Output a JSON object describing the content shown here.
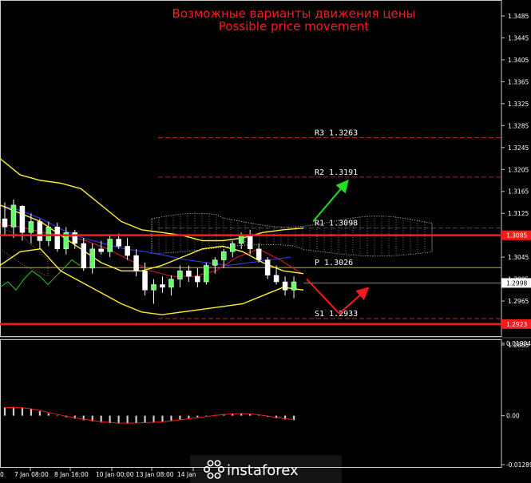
{
  "header": {
    "title_ru": "Возможные варианты движения цены",
    "title_en": "Possible price movement"
  },
  "chart_data": {
    "type": "candlestick",
    "ylim": [
      1.2885,
      1.3485
    ],
    "price_ticks": [
      "1.3485",
      "1.3445",
      "1.3405",
      "1.3365",
      "1.3325",
      "1.3285",
      "1.3245",
      "1.3205",
      "1.3165",
      "1.3125",
      "1.3085",
      "1.3045",
      "1.3005",
      "1.2965",
      "1.2925",
      "1.2885"
    ],
    "x_ticks": [
      "7 Jan 08:00",
      "8 Jan 16:00",
      "10 Jan 00:00",
      "13 Jan 08:00",
      "14 Jan"
    ],
    "x_tick_first": "0",
    "levels": [
      {
        "label": "R3",
        "value": "1.3263"
      },
      {
        "label": "R2",
        "value": "1.3191"
      },
      {
        "label": "R1",
        "value": "1.3098"
      },
      {
        "label": "P",
        "value": "1.3026"
      },
      {
        "label": "S1",
        "value": "1.2933"
      }
    ],
    "support_line": "1.3085",
    "resistance_line": "1.2923",
    "current_price": "1.2998",
    "candles": [
      [
        1.3115,
        1.3145,
        1.3085,
        1.31
      ],
      [
        1.31,
        1.315,
        1.308,
        1.314
      ],
      [
        1.3138,
        1.314,
        1.3075,
        1.309
      ],
      [
        1.309,
        1.3125,
        1.307,
        1.311
      ],
      [
        1.311,
        1.3115,
        1.306,
        1.3075
      ],
      [
        1.3075,
        1.311,
        1.3065,
        1.31
      ],
      [
        1.31,
        1.3108,
        1.3055,
        1.306
      ],
      [
        1.306,
        1.31,
        1.305,
        1.309
      ],
      [
        1.309,
        1.3095,
        1.306,
        1.307
      ],
      [
        1.307,
        1.308,
        1.302,
        1.3025
      ],
      [
        1.3025,
        1.307,
        1.3015,
        1.306
      ],
      [
        1.306,
        1.3075,
        1.305,
        1.3055
      ],
      [
        1.3055,
        1.3085,
        1.3045,
        1.3078
      ],
      [
        1.3078,
        1.3088,
        1.306,
        1.3065
      ],
      [
        1.3065,
        1.308,
        1.304,
        1.3048
      ],
      [
        1.3048,
        1.306,
        1.301,
        1.302
      ],
      [
        1.302,
        1.3035,
        1.2975,
        1.2985
      ],
      [
        1.2985,
        1.3005,
        1.296,
        1.2995
      ],
      [
        1.2995,
        1.301,
        1.298,
        1.299
      ],
      [
        1.299,
        1.3012,
        1.2975,
        1.3005
      ],
      [
        1.3005,
        1.303,
        1.299,
        1.302
      ],
      [
        1.302,
        1.303,
        1.3,
        1.301
      ],
      [
        1.301,
        1.3025,
        1.299,
        1.3
      ],
      [
        1.3,
        1.3035,
        1.2995,
        1.303
      ],
      [
        1.303,
        1.3045,
        1.3015,
        1.304
      ],
      [
        1.304,
        1.306,
        1.3025,
        1.3055
      ],
      [
        1.3055,
        1.3075,
        1.3045,
        1.307
      ],
      [
        1.307,
        1.309,
        1.306,
        1.3085
      ],
      [
        1.3085,
        1.3095,
        1.305,
        1.306
      ],
      [
        1.306,
        1.307,
        1.3035,
        1.304
      ],
      [
        1.304,
        1.3045,
        1.3005,
        1.3012
      ],
      [
        1.3012,
        1.303,
        1.2995,
        1.3
      ],
      [
        1.3,
        1.301,
        1.2975,
        1.2985
      ],
      [
        1.2985,
        1.301,
        1.297,
        1.3
      ]
    ],
    "yellow_upper": [
      1.3225,
      1.3195,
      1.3185,
      1.318,
      1.317,
      1.314,
      1.311,
      1.3095,
      1.309,
      1.3085,
      1.3075,
      1.3075,
      1.308,
      1.309,
      1.3095,
      1.3098
    ],
    "yellow_mid": [
      1.314,
      1.3125,
      1.311,
      1.3085,
      1.306,
      1.3035,
      1.302,
      1.302,
      1.303,
      1.3045,
      1.306,
      1.3065,
      1.3055,
      1.3035,
      1.302,
      1.3015
    ],
    "yellow_lower": [
      1.303,
      1.3055,
      1.306,
      1.302,
      1.3,
      1.298,
      1.296,
      1.2945,
      1.294,
      1.2945,
      1.295,
      1.2955,
      1.296,
      1.2975,
      1.299,
      1.2985
    ],
    "osc_ticks": [
      "0.01904",
      "0.00",
      "-0.01289"
    ],
    "osc_values": [
      0.0022,
      0.0023,
      0.0021,
      0.0017,
      0.0012,
      0.0006,
      0.0001,
      -0.0004,
      -0.0008,
      -0.0012,
      -0.0015,
      -0.0018,
      -0.002,
      -0.0021,
      -0.0021,
      -0.002,
      -0.0019,
      -0.0018,
      -0.0016,
      -0.0013,
      -0.001,
      -0.0007,
      -0.0004,
      -0.0001,
      0.0002,
      0.0004,
      0.0006,
      0.0006,
      0.0004,
      0.0001,
      -0.0003,
      -0.0007,
      -0.001,
      -0.0012
    ],
    "logo_text": "instaforex"
  }
}
